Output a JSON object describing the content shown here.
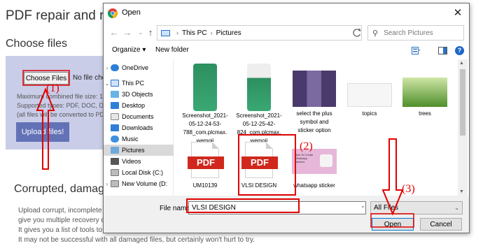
{
  "page": {
    "title": "PDF repair and re",
    "choose_heading": "Choose files",
    "choose_button": "Choose Files",
    "no_file": "No file chose",
    "info_lines": [
      "Maximum combined file size: 1",
      "Supported types: PDF, DOC, DO",
      "(all files will be converted to PD"
    ],
    "upload_button": "Upload files!",
    "corrupted_heading": "Corrupted, damag",
    "paragraph_lines": [
      "Upload corrupt, incomplete",
      "give you multiple recovery c",
      "It gives you a list of tools to",
      "It may not be successful with all damaged files, but certainly won't hurt to try."
    ]
  },
  "dialog": {
    "title": "Open",
    "close_glyph": "✕",
    "breadcrumb": [
      "This PC",
      "Pictures"
    ],
    "search_placeholder": "Search Pictures",
    "toolbar": {
      "organize": "Organize ▾",
      "new_folder": "New folder",
      "help": "?"
    },
    "nav_items": [
      "OneDrive",
      "This PC",
      "3D Objects",
      "Desktop",
      "Documents",
      "Downloads",
      "Music",
      "Pictures",
      "Videos",
      "Local Disk (C:)",
      "New Volume (D:"
    ],
    "files": [
      {
        "name_lines": [
          "Screenshot_2021-",
          "05-12-24-53-",
          "788_com.plcmax.",
          "wemoji"
        ]
      },
      {
        "name_lines": [
          "Screenshot_2021-",
          "05-12-25-42-",
          "824_com.plcmax.",
          "wemoji"
        ]
      },
      {
        "name_lines": [
          "select the plus",
          "symbol and",
          "sticker option"
        ]
      },
      {
        "name_lines": [
          "topics"
        ]
      },
      {
        "name_lines": [
          "trees"
        ]
      },
      {
        "name_lines": [
          "UM10139"
        ],
        "pdf_label": "PDF"
      },
      {
        "name_lines": [
          "VLSI DESIGN"
        ],
        "pdf_label": "PDF"
      },
      {
        "name_lines": [
          "whatsapp sticker"
        ],
        "thumb_text": "How To Create Whatsapp Stickers"
      }
    ],
    "file_name_label": "File name:",
    "file_name_value": "VLSI DESIGN",
    "file_type": "All Files",
    "open_button": "Open",
    "cancel_button": "Cancel"
  },
  "annotations": {
    "step1": "(1)",
    "step2": "(2)",
    "step3": "(3)",
    "color": "#e00000"
  }
}
